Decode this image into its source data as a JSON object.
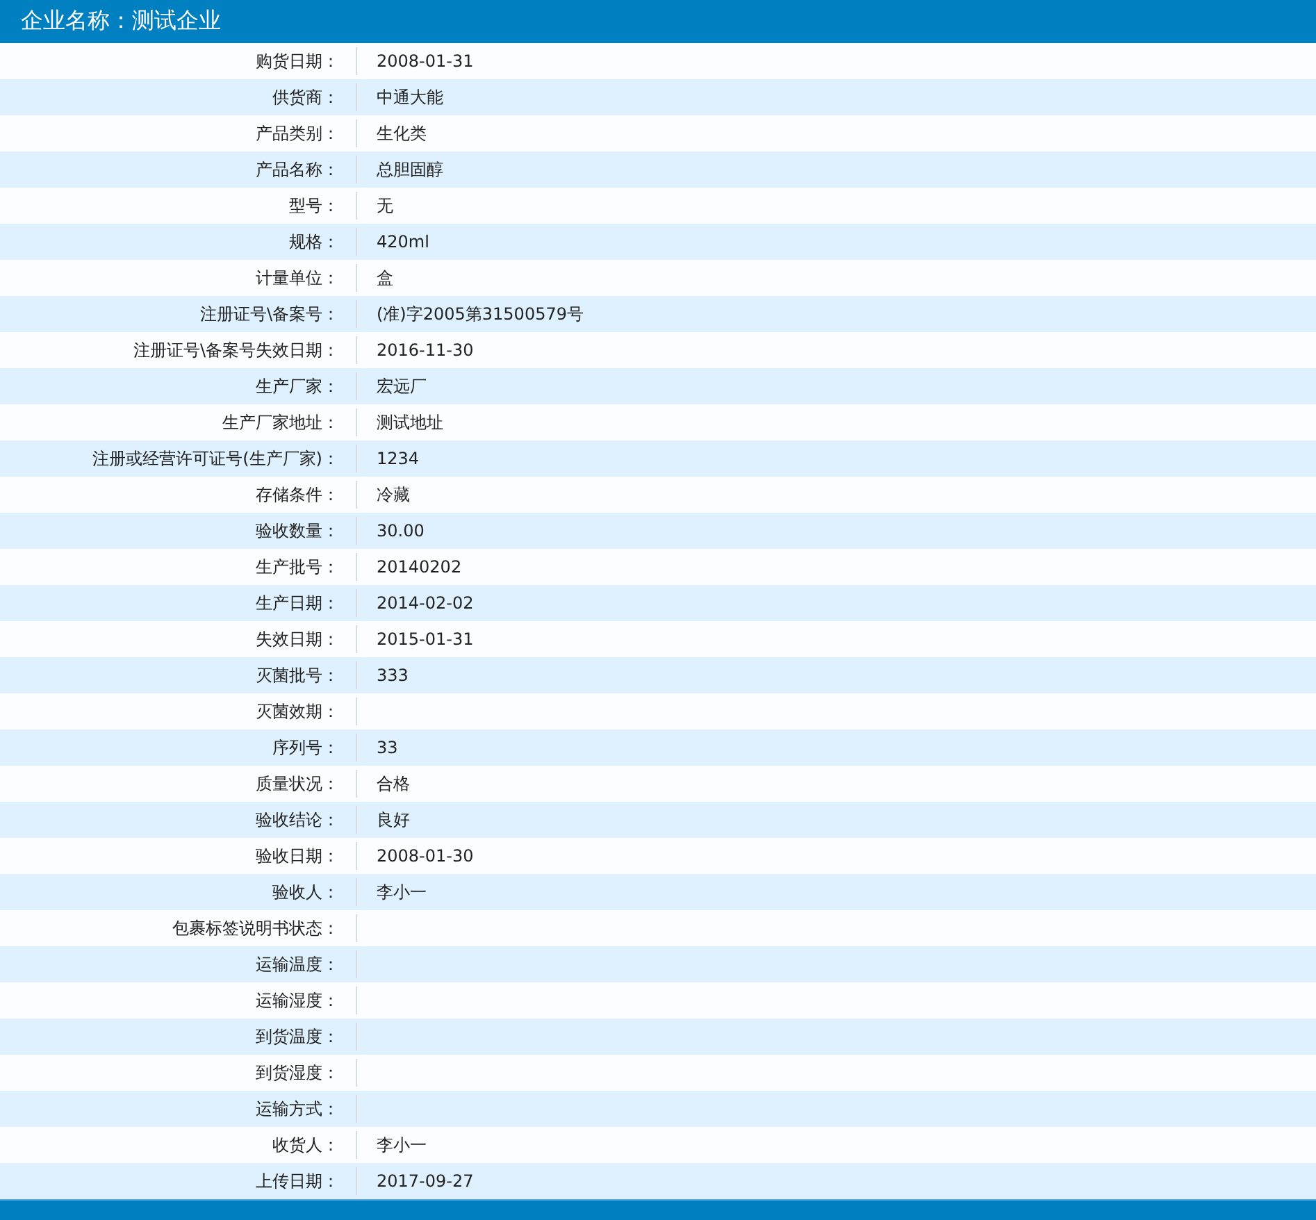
{
  "header": {
    "title": "企业名称：测试企业"
  },
  "rows": [
    {
      "label": "购货日期：",
      "value": "2008-01-31"
    },
    {
      "label": "供货商：",
      "value": "中通大能"
    },
    {
      "label": "产品类别：",
      "value": "生化类"
    },
    {
      "label": "产品名称：",
      "value": "总胆固醇"
    },
    {
      "label": "型号：",
      "value": "无"
    },
    {
      "label": "规格：",
      "value": "420ml"
    },
    {
      "label": "计量单位：",
      "value": "盒"
    },
    {
      "label": "注册证号\\备案号：",
      "value": "(准)字2005第31500579号"
    },
    {
      "label": "注册证号\\备案号失效日期：",
      "value": "2016-11-30"
    },
    {
      "label": "生产厂家：",
      "value": "宏远厂"
    },
    {
      "label": "生产厂家地址：",
      "value": "测试地址"
    },
    {
      "label": "注册或经营许可证号(生产厂家)：",
      "value": "1234"
    },
    {
      "label": "存储条件：",
      "value": "冷藏"
    },
    {
      "label": "验收数量：",
      "value": "30.00"
    },
    {
      "label": "生产批号：",
      "value": "20140202"
    },
    {
      "label": "生产日期：",
      "value": "2014-02-02"
    },
    {
      "label": "失效日期：",
      "value": "2015-01-31"
    },
    {
      "label": "灭菌批号：",
      "value": "333"
    },
    {
      "label": "灭菌效期："
    },
    {
      "label": "序列号：",
      "value": "33"
    },
    {
      "label": "质量状况：",
      "value": "合格"
    },
    {
      "label": "验收结论：",
      "value": "良好"
    },
    {
      "label": "验收日期：",
      "value": "2008-01-30"
    },
    {
      "label": "验收人：",
      "value": "李小一"
    },
    {
      "label": "包裹标签说明书状态："
    },
    {
      "label": "运输温度："
    },
    {
      "label": "运输湿度："
    },
    {
      "label": "到货温度："
    },
    {
      "label": "到货湿度："
    },
    {
      "label": "运输方式："
    },
    {
      "label": "收货人：",
      "value": "李小一"
    },
    {
      "label": "上传日期：",
      "value": "2017-09-27"
    }
  ]
}
